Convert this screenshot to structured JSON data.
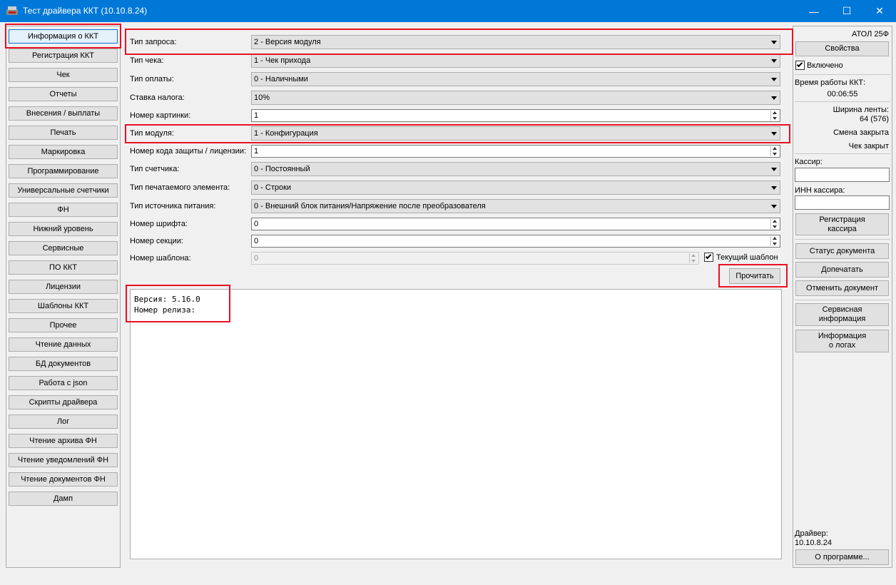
{
  "window": {
    "title": "Тест драйвера ККТ (10.10.8.24)",
    "minimize": "—",
    "maximize": "☐",
    "close": "✕"
  },
  "nav": [
    "Информация о ККТ",
    "Регистрация ККТ",
    "Чек",
    "Отчеты",
    "Внесения / выплаты",
    "Печать",
    "Маркировка",
    "Программирование",
    "Универсальные счетчики",
    "ФН",
    "Нижний уровень",
    "Сервисные",
    "ПО ККТ",
    "Лицензии",
    "Шаблоны ККТ",
    "Прочее",
    "Чтение данных",
    "БД документов",
    "Работа с json",
    "Скрипты драйвера",
    "Лог",
    "Чтение архива ФН",
    "Чтение уведомлений ФН",
    "Чтение документов ФН",
    "Дамп"
  ],
  "form": {
    "request_type": {
      "label": "Тип запроса:",
      "value": "2 - Версия модуля"
    },
    "receipt_type": {
      "label": "Тип чека:",
      "value": "1 - Чек прихода"
    },
    "payment_type": {
      "label": "Тип оплаты:",
      "value": "0 - Наличными"
    },
    "tax_rate": {
      "label": "Ставка налога:",
      "value": "10%"
    },
    "picture_number": {
      "label": "Номер картинки:",
      "value": "1"
    },
    "module_type": {
      "label": "Тип модуля:",
      "value": "1 - Конфигурация"
    },
    "license_code": {
      "label": "Номер кода защиты / лицензии:",
      "value": "1"
    },
    "counter_type": {
      "label": "Тип счетчика:",
      "value": "0 - Постоянный"
    },
    "print_element_type": {
      "label": "Тип печатаемого элемента:",
      "value": "0 - Строки"
    },
    "power_source_type": {
      "label": "Тип источника питания:",
      "value": "0 - Внешний блок питания/Напряжение после преобразователя"
    },
    "font_number": {
      "label": "Номер шрифта:",
      "value": "0"
    },
    "section_number": {
      "label": "Номер секции:",
      "value": "0"
    },
    "template_number": {
      "label": "Номер шаблона:",
      "value": "0"
    },
    "current_template": {
      "label": "Текущий шаблон",
      "checked": true
    },
    "read_button": "Прочитать"
  },
  "output": {
    "line1": "Версия: 5.16.0",
    "line2": "Номер релиза:"
  },
  "right": {
    "model": "АТОЛ 25Ф",
    "properties_button": "Свойства",
    "enabled_label": "Включено",
    "enabled": true,
    "uptime_label": "Время работы ККТ:",
    "uptime_value": "00:06:55",
    "tape_width_label": "Ширина ленты:",
    "tape_width_value": "64 (576)",
    "shift_status": "Смена закрыта",
    "receipt_status": "Чек закрыт",
    "cashier_label": "Кассир:",
    "cashier_value": "",
    "cashier_inn_label": "ИНН кассира:",
    "cashier_inn_value": "",
    "register_cashier_line1": "Регистрация",
    "register_cashier_line2": "кассира",
    "doc_status_button": "Статус документа",
    "reprint_button": "Допечатать",
    "cancel_doc_button": "Отменить документ",
    "service_info_line1": "Сервисная",
    "service_info_line2": "информация",
    "logs_info_line1": "Информация",
    "logs_info_line2": "о логах",
    "driver_label": "Драйвер:",
    "driver_version": "10.10.8.24",
    "about_button": "О программе..."
  },
  "colors": {
    "titlebar": "#0078d7",
    "highlight": "#e81123"
  }
}
